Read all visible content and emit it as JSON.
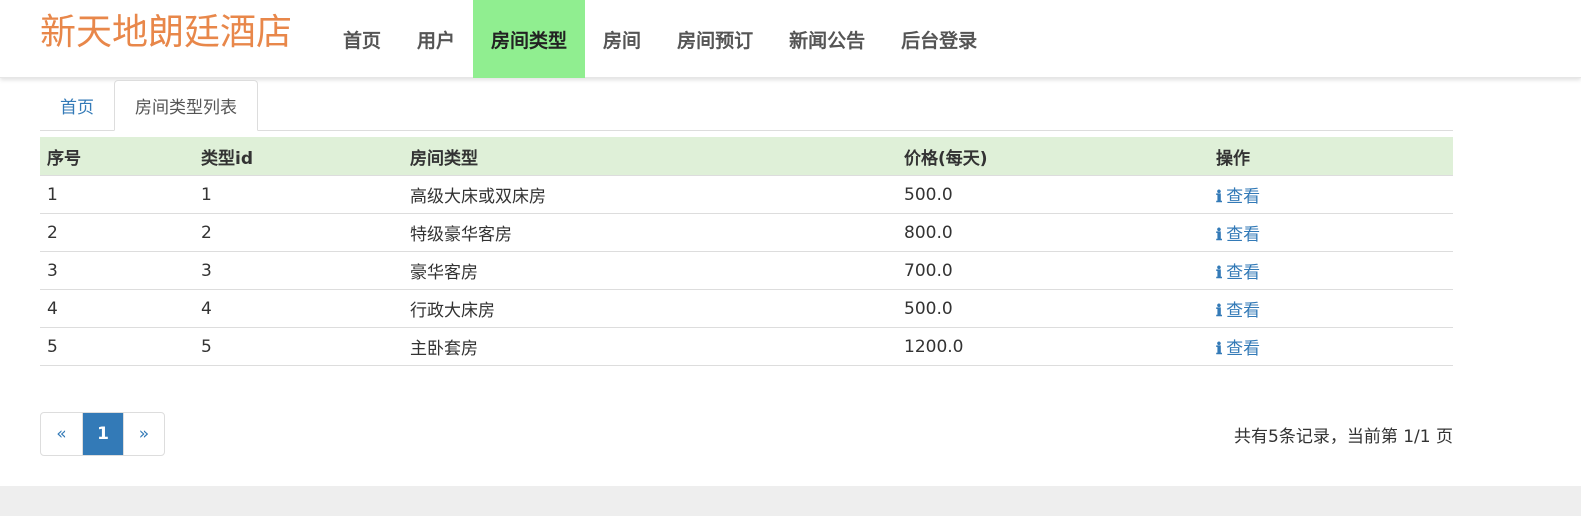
{
  "header": {
    "brand": "新天地朗廷酒店",
    "nav": [
      {
        "label": "首页",
        "active": false
      },
      {
        "label": "用户",
        "active": false
      },
      {
        "label": "房间类型",
        "active": true
      },
      {
        "label": "房间",
        "active": false
      },
      {
        "label": "房间预订",
        "active": false
      },
      {
        "label": "新闻公告",
        "active": false
      },
      {
        "label": "后台登录",
        "active": false
      }
    ]
  },
  "breadcrumb": {
    "home": "首页",
    "current": "房间类型列表"
  },
  "table": {
    "columns": [
      "序号",
      "类型id",
      "房间类型",
      "价格(每天)",
      "操作"
    ],
    "rows": [
      {
        "index": "1",
        "type_id": "1",
        "room_type": "高级大床或双床房",
        "price": "500.0",
        "action": "查看"
      },
      {
        "index": "2",
        "type_id": "2",
        "room_type": "特级豪华客房",
        "price": "800.0",
        "action": "查看"
      },
      {
        "index": "3",
        "type_id": "3",
        "room_type": "豪华客房",
        "price": "700.0",
        "action": "查看"
      },
      {
        "index": "4",
        "type_id": "4",
        "room_type": "行政大床房",
        "price": "500.0",
        "action": "查看"
      },
      {
        "index": "5",
        "type_id": "5",
        "room_type": "主卧套房",
        "price": "1200.0",
        "action": "查看"
      }
    ],
    "action_icon": "info-icon"
  },
  "pagination": {
    "prev": "«",
    "current": "1",
    "next": "»",
    "summary": "共有5条记录，当前第 1/1 页"
  },
  "colors": {
    "brand": "#e8874a",
    "active_nav": "#90ee90",
    "header_row": "#dff0d8",
    "link": "#337ab7"
  }
}
